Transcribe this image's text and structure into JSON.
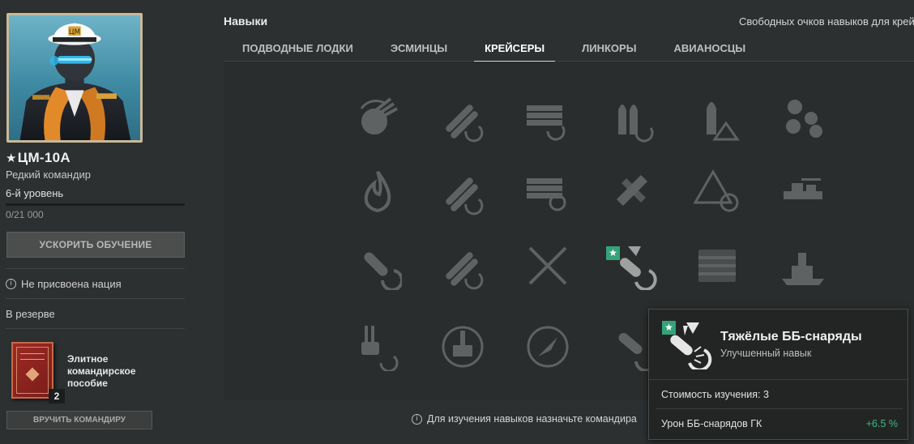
{
  "commander": {
    "name": "ЦМ-10А",
    "star": "★",
    "rarity": "Редкий командир",
    "level": "6-й уровень",
    "xp_progress": 0,
    "xp_text": "0/21 000",
    "accelerate_button": "Ускорить обучение",
    "nation_info_icon": "i",
    "nation": "Не присвоена нация",
    "reserve_label": "В резерве"
  },
  "elite_book": {
    "title": "Элитное командирское пособие",
    "count": "2",
    "give_button": "Вручить командиру"
  },
  "skills": {
    "title": "Навыки",
    "free_points_label": "Свободных очков навыков для крей",
    "tabs": [
      {
        "label": "Подводные лодки",
        "active": false
      },
      {
        "label": "Эсминцы",
        "active": false
      },
      {
        "label": "Крейсеры",
        "active": true
      },
      {
        "label": "Линкоры",
        "active": false
      },
      {
        "label": "Авианосцы",
        "active": false
      }
    ],
    "grid_icons": [
      [
        "turret-traverse-icon",
        "torpedo-reload-icon",
        "ammo-reload-icon",
        "shell-reload-icon",
        "shell-warning-icon",
        "aa-defense-icon"
      ],
      [
        "fire-icon",
        "torpedo-speed-icon",
        "magazine-reload-icon",
        "aircraft-target-icon",
        "warning-crosshair-icon",
        "ship-turrets-icon"
      ],
      [
        "he-shell-icon",
        "torpedo-crew-icon",
        "crossed-swords-icon",
        "heavy-ap-shells-icon",
        "ammo-rack-icon",
        "battleship-icon"
      ],
      [
        "main-battery-reload-icon",
        "ship-front-icon",
        "radar-compass-icon",
        "heavy-shell-burst-icon"
      ]
    ],
    "bottom_note": "Для изучения навыков назначьте командира"
  },
  "tooltip": {
    "title": "Тяжёлые ББ-снаряды",
    "subtitle": "Улучшенный навык",
    "cost": "Стоимость изучения: 3",
    "stat_label": "Урон ББ-снарядов ГК",
    "stat_value": "+6.5 %",
    "star": "★"
  },
  "colors": {
    "accent_green": "#34a37a",
    "positive_value": "#3fb983",
    "background": "#2d3030"
  }
}
